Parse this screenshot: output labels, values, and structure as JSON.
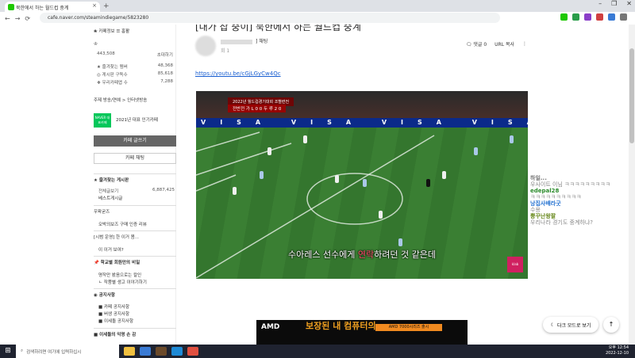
{
  "browser": {
    "tab_title": "북한에서 하는 월드컵 중계",
    "close_label": "×",
    "new_tab_label": "+",
    "url": "cafe.naver.com/steamindiegame/5823280",
    "window_controls": [
      "–",
      "❐",
      "✕"
    ],
    "nav": [
      "←",
      "→",
      "⟳"
    ]
  },
  "sidebar": {
    "top_links": "❀ 카페정보  ☰ 홈활",
    "member": "♔",
    "member_count": "443,508",
    "invite_label": "초대하기",
    "stats": [
      {
        "label": "★ 즐겨찾는 멤버",
        "value": "48,368"
      },
      {
        "label": "◎ 게시판 구독수",
        "value": "85,618"
      },
      {
        "label": "❖ 우리카페앱 수",
        "value": "7,288"
      }
    ],
    "theme_line": "주제 방송/연예 > 인터넷방송",
    "badge": "NAVER 대표카페",
    "award": "2021년 대표 인기카페",
    "write_button": "카페 글쓰기",
    "chat_button": "카페 채팅",
    "fav_board": "★ 즐겨찾는 게시판",
    "all_posts": "전체글보기",
    "all_posts_count": "6,887,425",
    "best_posts": "베스트게시글",
    "section_goods": "우왁굳즈",
    "goods_item": "오박의보즈 구매 인증 리뷰",
    "section_event": "[시범 운영] 한 이거 봄...",
    "event_item": "이 이거 보여?",
    "section_vote": "📌 학교별 회원만의 비밀",
    "vote_item1": "명작만 봤음으로는 칼인",
    "vote_item2": "ㄴ 작품별 생고 이야기하기",
    "section_notice": "◉ 공지사항",
    "notice_items": [
      "■ 카페 공지사항",
      "■ 버생 공지사항",
      "■ 이세돌 공지사항"
    ],
    "section_last": "■ 이세돌의 익명 손 감"
  },
  "post": {
    "title": "[내가 잡 중이] 북한에서 하는 월드컵 중계",
    "author_suffix": "] 채팅",
    "date": "회 1",
    "comments": "댓글 0",
    "url_copy": "URL 복사",
    "more_icon": "⋮",
    "link": "https://youtu.be/cGjLGyCw4Qc"
  },
  "video": {
    "score_line1": "2022년 월드컵경기대회 조별련전",
    "score_line2": "전반전 가 L 0 0 두 루 2 0",
    "adboard": "VISA VISA VISA VISA VISA VISA VISA VISA",
    "subtitle_pre": "수아레스 선수에게 ",
    "subtitle_red": "연락",
    "subtitle_post": "하려던 것 같은데",
    "logo": "klab"
  },
  "ad": {
    "brand": "AMD",
    "headline": "보장된 내 컴퓨터의",
    "chip": "AMD 7000시리즈 출시"
  },
  "chat": [
    {
      "name": "하일...",
      "text": "",
      "color": "#777"
    },
    {
      "name": "",
      "text": "우사이트 이님 ㅋㅋㅋㅋㅋㅋㅋㅋㅋ",
      "color": "#888"
    },
    {
      "name": "edepal28",
      "text": "",
      "color": "#2a8a2a"
    },
    {
      "name": "",
      "text": "ㅋㅋㅋㅋㅋㅋㅋㅋㅋㅋ",
      "color": "#888"
    },
    {
      "name": "낭집사배라굿",
      "text": "",
      "color": "#1f6fd0"
    },
    {
      "name": "",
      "text": "수용",
      "color": "#888"
    },
    {
      "name": "뿡꾸난왕팔",
      "text": "",
      "color": "#6a8a1f"
    },
    {
      "name": "",
      "text": "우리나라 경기도 중계하냐?",
      "color": "#888"
    }
  ],
  "dark_mode_label": "다크 모드로 보기",
  "to_top_icon": "↑",
  "taskbar": {
    "start_icon": "⊞",
    "search_placeholder": "검색하려면 여기에 입력하십시",
    "time": "오후 12:54",
    "date": "2022-12-10"
  }
}
